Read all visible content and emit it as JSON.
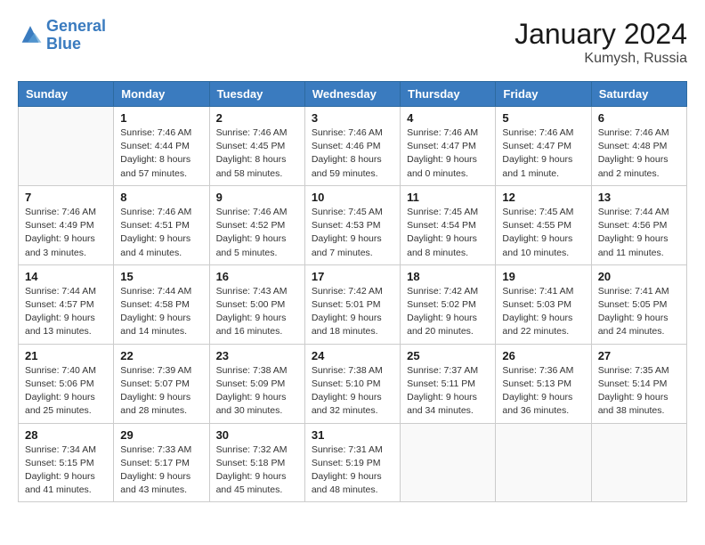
{
  "header": {
    "logo_line1": "General",
    "logo_line2": "Blue",
    "title": "January 2024",
    "subtitle": "Kumysh, Russia"
  },
  "columns": [
    "Sunday",
    "Monday",
    "Tuesday",
    "Wednesday",
    "Thursday",
    "Friday",
    "Saturday"
  ],
  "weeks": [
    [
      {
        "day": "",
        "sunrise": "",
        "sunset": "",
        "daylight": ""
      },
      {
        "day": "1",
        "sunrise": "Sunrise: 7:46 AM",
        "sunset": "Sunset: 4:44 PM",
        "daylight": "Daylight: 8 hours and 57 minutes."
      },
      {
        "day": "2",
        "sunrise": "Sunrise: 7:46 AM",
        "sunset": "Sunset: 4:45 PM",
        "daylight": "Daylight: 8 hours and 58 minutes."
      },
      {
        "day": "3",
        "sunrise": "Sunrise: 7:46 AM",
        "sunset": "Sunset: 4:46 PM",
        "daylight": "Daylight: 8 hours and 59 minutes."
      },
      {
        "day": "4",
        "sunrise": "Sunrise: 7:46 AM",
        "sunset": "Sunset: 4:47 PM",
        "daylight": "Daylight: 9 hours and 0 minutes."
      },
      {
        "day": "5",
        "sunrise": "Sunrise: 7:46 AM",
        "sunset": "Sunset: 4:47 PM",
        "daylight": "Daylight: 9 hours and 1 minute."
      },
      {
        "day": "6",
        "sunrise": "Sunrise: 7:46 AM",
        "sunset": "Sunset: 4:48 PM",
        "daylight": "Daylight: 9 hours and 2 minutes."
      }
    ],
    [
      {
        "day": "7",
        "sunrise": "Sunrise: 7:46 AM",
        "sunset": "Sunset: 4:49 PM",
        "daylight": "Daylight: 9 hours and 3 minutes."
      },
      {
        "day": "8",
        "sunrise": "Sunrise: 7:46 AM",
        "sunset": "Sunset: 4:51 PM",
        "daylight": "Daylight: 9 hours and 4 minutes."
      },
      {
        "day": "9",
        "sunrise": "Sunrise: 7:46 AM",
        "sunset": "Sunset: 4:52 PM",
        "daylight": "Daylight: 9 hours and 5 minutes."
      },
      {
        "day": "10",
        "sunrise": "Sunrise: 7:45 AM",
        "sunset": "Sunset: 4:53 PM",
        "daylight": "Daylight: 9 hours and 7 minutes."
      },
      {
        "day": "11",
        "sunrise": "Sunrise: 7:45 AM",
        "sunset": "Sunset: 4:54 PM",
        "daylight": "Daylight: 9 hours and 8 minutes."
      },
      {
        "day": "12",
        "sunrise": "Sunrise: 7:45 AM",
        "sunset": "Sunset: 4:55 PM",
        "daylight": "Daylight: 9 hours and 10 minutes."
      },
      {
        "day": "13",
        "sunrise": "Sunrise: 7:44 AM",
        "sunset": "Sunset: 4:56 PM",
        "daylight": "Daylight: 9 hours and 11 minutes."
      }
    ],
    [
      {
        "day": "14",
        "sunrise": "Sunrise: 7:44 AM",
        "sunset": "Sunset: 4:57 PM",
        "daylight": "Daylight: 9 hours and 13 minutes."
      },
      {
        "day": "15",
        "sunrise": "Sunrise: 7:44 AM",
        "sunset": "Sunset: 4:58 PM",
        "daylight": "Daylight: 9 hours and 14 minutes."
      },
      {
        "day": "16",
        "sunrise": "Sunrise: 7:43 AM",
        "sunset": "Sunset: 5:00 PM",
        "daylight": "Daylight: 9 hours and 16 minutes."
      },
      {
        "day": "17",
        "sunrise": "Sunrise: 7:42 AM",
        "sunset": "Sunset: 5:01 PM",
        "daylight": "Daylight: 9 hours and 18 minutes."
      },
      {
        "day": "18",
        "sunrise": "Sunrise: 7:42 AM",
        "sunset": "Sunset: 5:02 PM",
        "daylight": "Daylight: 9 hours and 20 minutes."
      },
      {
        "day": "19",
        "sunrise": "Sunrise: 7:41 AM",
        "sunset": "Sunset: 5:03 PM",
        "daylight": "Daylight: 9 hours and 22 minutes."
      },
      {
        "day": "20",
        "sunrise": "Sunrise: 7:41 AM",
        "sunset": "Sunset: 5:05 PM",
        "daylight": "Daylight: 9 hours and 24 minutes."
      }
    ],
    [
      {
        "day": "21",
        "sunrise": "Sunrise: 7:40 AM",
        "sunset": "Sunset: 5:06 PM",
        "daylight": "Daylight: 9 hours and 25 minutes."
      },
      {
        "day": "22",
        "sunrise": "Sunrise: 7:39 AM",
        "sunset": "Sunset: 5:07 PM",
        "daylight": "Daylight: 9 hours and 28 minutes."
      },
      {
        "day": "23",
        "sunrise": "Sunrise: 7:38 AM",
        "sunset": "Sunset: 5:09 PM",
        "daylight": "Daylight: 9 hours and 30 minutes."
      },
      {
        "day": "24",
        "sunrise": "Sunrise: 7:38 AM",
        "sunset": "Sunset: 5:10 PM",
        "daylight": "Daylight: 9 hours and 32 minutes."
      },
      {
        "day": "25",
        "sunrise": "Sunrise: 7:37 AM",
        "sunset": "Sunset: 5:11 PM",
        "daylight": "Daylight: 9 hours and 34 minutes."
      },
      {
        "day": "26",
        "sunrise": "Sunrise: 7:36 AM",
        "sunset": "Sunset: 5:13 PM",
        "daylight": "Daylight: 9 hours and 36 minutes."
      },
      {
        "day": "27",
        "sunrise": "Sunrise: 7:35 AM",
        "sunset": "Sunset: 5:14 PM",
        "daylight": "Daylight: 9 hours and 38 minutes."
      }
    ],
    [
      {
        "day": "28",
        "sunrise": "Sunrise: 7:34 AM",
        "sunset": "Sunset: 5:15 PM",
        "daylight": "Daylight: 9 hours and 41 minutes."
      },
      {
        "day": "29",
        "sunrise": "Sunrise: 7:33 AM",
        "sunset": "Sunset: 5:17 PM",
        "daylight": "Daylight: 9 hours and 43 minutes."
      },
      {
        "day": "30",
        "sunrise": "Sunrise: 7:32 AM",
        "sunset": "Sunset: 5:18 PM",
        "daylight": "Daylight: 9 hours and 45 minutes."
      },
      {
        "day": "31",
        "sunrise": "Sunrise: 7:31 AM",
        "sunset": "Sunset: 5:19 PM",
        "daylight": "Daylight: 9 hours and 48 minutes."
      },
      {
        "day": "",
        "sunrise": "",
        "sunset": "",
        "daylight": ""
      },
      {
        "day": "",
        "sunrise": "",
        "sunset": "",
        "daylight": ""
      },
      {
        "day": "",
        "sunrise": "",
        "sunset": "",
        "daylight": ""
      }
    ]
  ]
}
